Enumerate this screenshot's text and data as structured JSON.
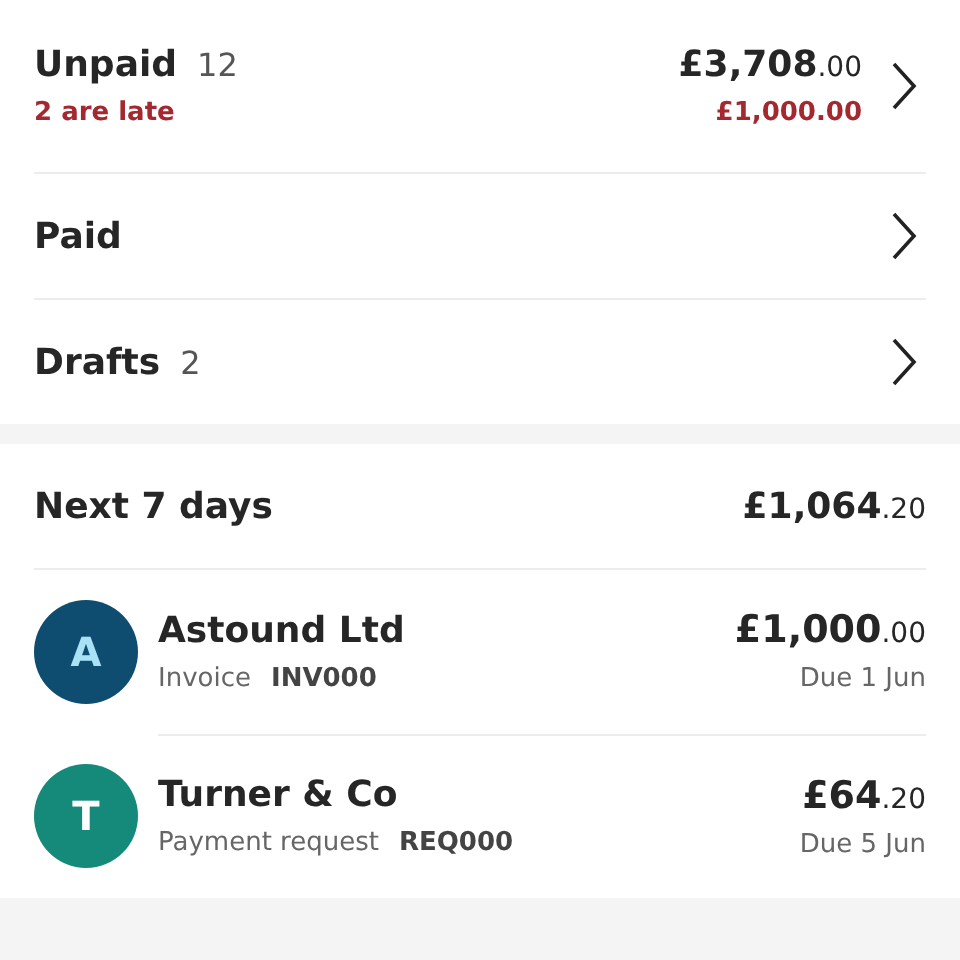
{
  "summary_rows": [
    {
      "label": "Unpaid",
      "count": "12",
      "note": "2 are late",
      "amount": {
        "main": "£3,708",
        "pence": ".00"
      },
      "late_amount": "£1,000.00"
    },
    {
      "label": "Paid"
    },
    {
      "label": "Drafts",
      "count": "2"
    }
  ],
  "upcoming": {
    "title": "Next 7 days",
    "total": {
      "main": "£1,064",
      "pence": ".20"
    },
    "items": [
      {
        "initial": "A",
        "color": "#0e4d70",
        "name": "Astound Ltd",
        "type": "Invoice",
        "ref": "INV000",
        "amount": {
          "main": "£1,000",
          "pence": ".00"
        },
        "due": "Due 1 Jun"
      },
      {
        "initial": "T",
        "color": "#15897a",
        "name": "Turner & Co",
        "type": "Payment request",
        "ref": "REQ000",
        "amount": {
          "main": "£64",
          "pence": ".20"
        },
        "due": "Due 5 Jun"
      }
    ]
  }
}
